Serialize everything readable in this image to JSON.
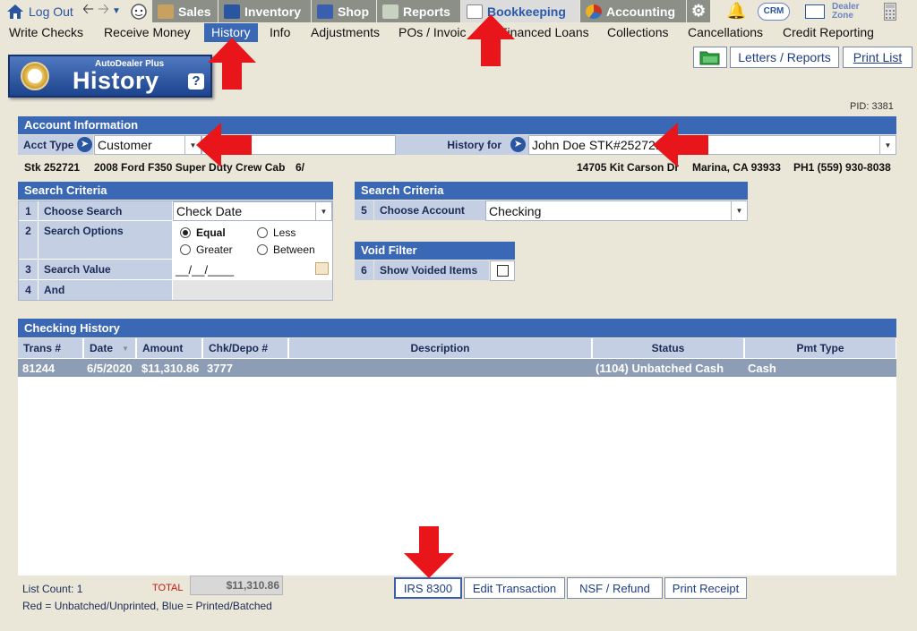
{
  "topbar": {
    "logout_label": "Log Out",
    "tabs": [
      {
        "label": "Sales"
      },
      {
        "label": "Inventory"
      },
      {
        "label": "Shop"
      },
      {
        "label": "Reports"
      },
      {
        "label": "Bookkeeping"
      },
      {
        "label": "Accounting"
      }
    ],
    "crm_label": "CRM",
    "dealer_zone_line1": "Dealer",
    "dealer_zone_line2": "Zone"
  },
  "submenu": [
    "Write Checks",
    "Receive Money",
    "History",
    "Info",
    "Adjustments",
    "POs / Invoic",
    "Financed Loans",
    "Collections",
    "Cancellations",
    "Credit Reporting"
  ],
  "badge": {
    "subtitle": "AutoDealer Plus",
    "title": "History",
    "help": "?"
  },
  "header_buttons": {
    "letters": "Letters / Reports",
    "print_list": "Print List"
  },
  "pid": "PID: 3381",
  "account_info": {
    "title": "Account Information",
    "acct_type_label": "Acct Type",
    "acct_type_value": "Customer",
    "history_for_label": "History for",
    "history_for_value": "John Doe  STK#252721",
    "stk": "Stk 252721",
    "vehicle": "2008 Ford F350 Super Duty Crew Cab",
    "vehicle_extra": "6/",
    "address": "14705 Kit Carson Dr",
    "city": "Marina, CA 93933",
    "phone": "PH1 (559) 930-8038"
  },
  "search_left": {
    "title": "Search Criteria",
    "rows": [
      {
        "num": "1",
        "label": "Choose Search",
        "value": "Check Date"
      },
      {
        "num": "2",
        "label": "Search Options"
      },
      {
        "num": "3",
        "label": "Search Value",
        "value": "__/__/____"
      },
      {
        "num": "4",
        "label": "And"
      }
    ],
    "options": [
      "Equal",
      "Less",
      "Greater",
      "Between"
    ],
    "selected_option": "Equal"
  },
  "search_right": {
    "title": "Search Criteria",
    "num": "5",
    "label": "Choose Account",
    "value": "Checking"
  },
  "void_filter": {
    "title": "Void Filter",
    "num": "6",
    "label": "Show Voided Items",
    "checked": false
  },
  "history": {
    "title": "Checking History",
    "columns": [
      "Trans #",
      "Date",
      "Amount",
      "Chk/Depo #",
      "Description",
      "Status",
      "Pmt Type"
    ],
    "rows": [
      {
        "trans": "81244",
        "date": "6/5/2020",
        "amount": "$11,310.86",
        "chk": "3777",
        "description": "",
        "status": "(1104) Unbatched Cash",
        "pmt": "Cash"
      }
    ]
  },
  "footer": {
    "list_count": "List Count: 1",
    "total_label": "TOTAL",
    "total_value": "$11,310.86",
    "legend": "Red = Unbatched/Unprinted, Blue = Printed/Batched",
    "buttons": [
      "IRS 8300",
      "Edit Transaction",
      "NSF / Refund",
      "Print Receipt"
    ]
  },
  "colors": {
    "accent": "#3a68b4",
    "arrow": "#e8151b",
    "row_selected": "#8e9db6"
  }
}
